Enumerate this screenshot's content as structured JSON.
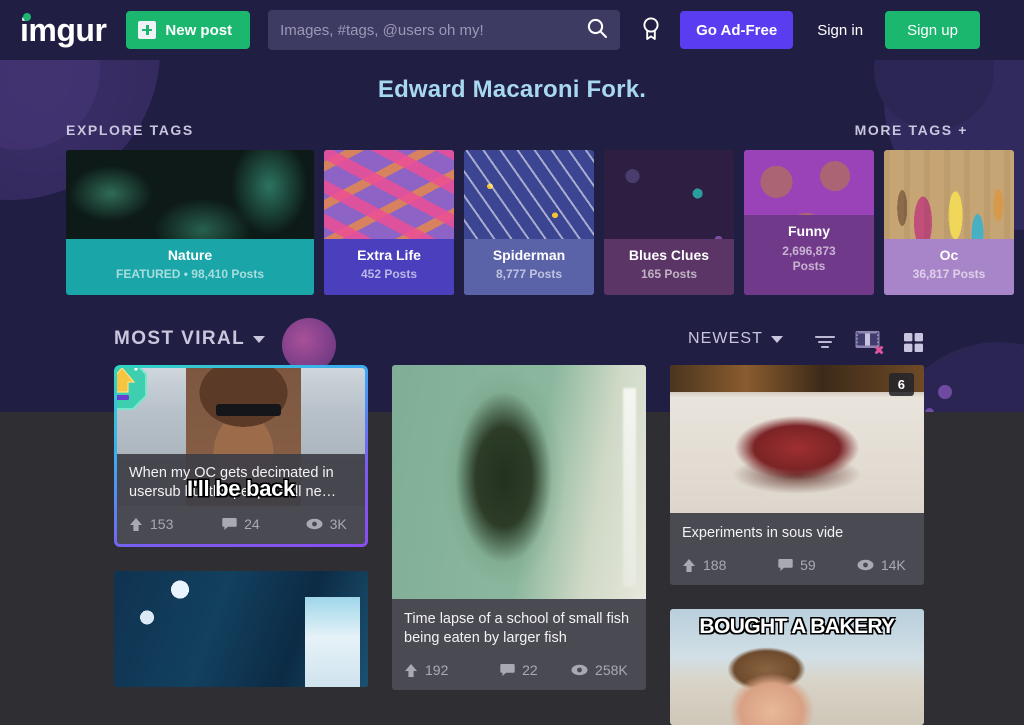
{
  "nav": {
    "logo": "imgur",
    "new_post_label": "New post",
    "search_placeholder": "Images, #tags, @users oh my!",
    "search_value": "",
    "ad_free_label": "Go Ad-Free",
    "sign_in_label": "Sign in",
    "sign_up_label": "Sign up",
    "colors": {
      "green": "#1bb76e",
      "purple": "#5a3df0",
      "navy": "#201e43",
      "search_bg": "#3d3b61"
    }
  },
  "banner": {
    "title": "Edward Macaroni Fork.",
    "title_color": "#a8d8f0",
    "explore_tags_label": "EXPLORE TAGS",
    "more_tags_label": "MORE TAGS +",
    "tags": [
      {
        "name": "Nature",
        "count": "FEATURED • 98,410 Posts",
        "foot_color": "#1aa5a8",
        "thumb": "th-nature",
        "wide": true
      },
      {
        "name": "Extra Life",
        "count": "452 Posts",
        "foot_color": "#4a3fbd",
        "thumb": "th-extralife",
        "wide": false
      },
      {
        "name": "Spiderman",
        "count": "8,777 Posts",
        "foot_color": "#5a62a8",
        "thumb": "th-spiderman",
        "wide": false
      },
      {
        "name": "Blues Clues",
        "count": "165 Posts",
        "foot_color": "#5b3566",
        "thumb": "th-blues",
        "wide": false
      },
      {
        "name": "Funny",
        "count": "2,696,873 Posts",
        "foot_color": "#70398a",
        "thumb": "th-funny",
        "wide": false
      },
      {
        "name": "Oc",
        "count": "36,817 Posts",
        "foot_color": "#a885c8",
        "thumb": "th-oc",
        "wide": false
      }
    ]
  },
  "sortbar": {
    "primary_sort": "MOST VIRAL",
    "secondary_sort": "NEWEST",
    "icons": [
      "filter-icon",
      "filmstrip-icon",
      "grid-icon"
    ]
  },
  "posts": {
    "col1": [
      {
        "title": "When my OC gets decimated in usersub but the people still ne…",
        "points": "153",
        "comments": "24",
        "views": "3K",
        "featured": true,
        "badge": "trophy-badge",
        "image_caption": "I'll be back",
        "image_art": "img-terminator"
      },
      {
        "title": "",
        "points": "",
        "comments": "",
        "views": "",
        "featured": false,
        "image_art": "img-ceiling"
      }
    ],
    "col2": [
      {
        "title": "Time lapse of a school of small fish being eaten by larger fish",
        "points": "192",
        "comments": "22",
        "views": "258K",
        "featured": false,
        "image_art": "img-fish"
      }
    ],
    "col3": [
      {
        "title": "Experiments in sous vide",
        "points": "188",
        "comments": "59",
        "views": "14K",
        "featured": false,
        "count_badge": "6",
        "image_art": "img-steak"
      },
      {
        "title": "",
        "points": "",
        "comments": "",
        "views": "",
        "featured": false,
        "image_caption": "BOUGHT A BAKERY",
        "image_art": "img-baby"
      }
    ]
  }
}
